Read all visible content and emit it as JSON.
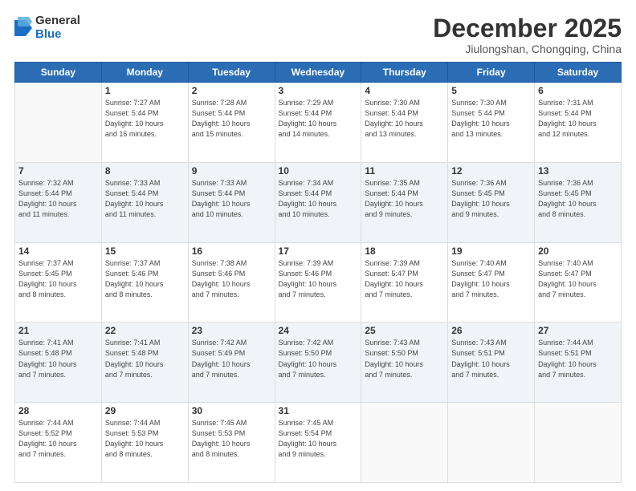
{
  "logo": {
    "general": "General",
    "blue": "Blue"
  },
  "header": {
    "month": "December 2025",
    "location": "Jiulongshan, Chongqing, China"
  },
  "weekdays": [
    "Sunday",
    "Monday",
    "Tuesday",
    "Wednesday",
    "Thursday",
    "Friday",
    "Saturday"
  ],
  "weeks": [
    [
      {
        "day": "",
        "info": ""
      },
      {
        "day": "1",
        "info": "Sunrise: 7:27 AM\nSunset: 5:44 PM\nDaylight: 10 hours\nand 16 minutes."
      },
      {
        "day": "2",
        "info": "Sunrise: 7:28 AM\nSunset: 5:44 PM\nDaylight: 10 hours\nand 15 minutes."
      },
      {
        "day": "3",
        "info": "Sunrise: 7:29 AM\nSunset: 5:44 PM\nDaylight: 10 hours\nand 14 minutes."
      },
      {
        "day": "4",
        "info": "Sunrise: 7:30 AM\nSunset: 5:44 PM\nDaylight: 10 hours\nand 13 minutes."
      },
      {
        "day": "5",
        "info": "Sunrise: 7:30 AM\nSunset: 5:44 PM\nDaylight: 10 hours\nand 13 minutes."
      },
      {
        "day": "6",
        "info": "Sunrise: 7:31 AM\nSunset: 5:44 PM\nDaylight: 10 hours\nand 12 minutes."
      }
    ],
    [
      {
        "day": "7",
        "info": "Sunrise: 7:32 AM\nSunset: 5:44 PM\nDaylight: 10 hours\nand 11 minutes."
      },
      {
        "day": "8",
        "info": "Sunrise: 7:33 AM\nSunset: 5:44 PM\nDaylight: 10 hours\nand 11 minutes."
      },
      {
        "day": "9",
        "info": "Sunrise: 7:33 AM\nSunset: 5:44 PM\nDaylight: 10 hours\nand 10 minutes."
      },
      {
        "day": "10",
        "info": "Sunrise: 7:34 AM\nSunset: 5:44 PM\nDaylight: 10 hours\nand 10 minutes."
      },
      {
        "day": "11",
        "info": "Sunrise: 7:35 AM\nSunset: 5:44 PM\nDaylight: 10 hours\nand 9 minutes."
      },
      {
        "day": "12",
        "info": "Sunrise: 7:36 AM\nSunset: 5:45 PM\nDaylight: 10 hours\nand 9 minutes."
      },
      {
        "day": "13",
        "info": "Sunrise: 7:36 AM\nSunset: 5:45 PM\nDaylight: 10 hours\nand 8 minutes."
      }
    ],
    [
      {
        "day": "14",
        "info": "Sunrise: 7:37 AM\nSunset: 5:45 PM\nDaylight: 10 hours\nand 8 minutes."
      },
      {
        "day": "15",
        "info": "Sunrise: 7:37 AM\nSunset: 5:46 PM\nDaylight: 10 hours\nand 8 minutes."
      },
      {
        "day": "16",
        "info": "Sunrise: 7:38 AM\nSunset: 5:46 PM\nDaylight: 10 hours\nand 7 minutes."
      },
      {
        "day": "17",
        "info": "Sunrise: 7:39 AM\nSunset: 5:46 PM\nDaylight: 10 hours\nand 7 minutes."
      },
      {
        "day": "18",
        "info": "Sunrise: 7:39 AM\nSunset: 5:47 PM\nDaylight: 10 hours\nand 7 minutes."
      },
      {
        "day": "19",
        "info": "Sunrise: 7:40 AM\nSunset: 5:47 PM\nDaylight: 10 hours\nand 7 minutes."
      },
      {
        "day": "20",
        "info": "Sunrise: 7:40 AM\nSunset: 5:47 PM\nDaylight: 10 hours\nand 7 minutes."
      }
    ],
    [
      {
        "day": "21",
        "info": "Sunrise: 7:41 AM\nSunset: 5:48 PM\nDaylight: 10 hours\nand 7 minutes."
      },
      {
        "day": "22",
        "info": "Sunrise: 7:41 AM\nSunset: 5:48 PM\nDaylight: 10 hours\nand 7 minutes."
      },
      {
        "day": "23",
        "info": "Sunrise: 7:42 AM\nSunset: 5:49 PM\nDaylight: 10 hours\nand 7 minutes."
      },
      {
        "day": "24",
        "info": "Sunrise: 7:42 AM\nSunset: 5:50 PM\nDaylight: 10 hours\nand 7 minutes."
      },
      {
        "day": "25",
        "info": "Sunrise: 7:43 AM\nSunset: 5:50 PM\nDaylight: 10 hours\nand 7 minutes."
      },
      {
        "day": "26",
        "info": "Sunrise: 7:43 AM\nSunset: 5:51 PM\nDaylight: 10 hours\nand 7 minutes."
      },
      {
        "day": "27",
        "info": "Sunrise: 7:44 AM\nSunset: 5:51 PM\nDaylight: 10 hours\nand 7 minutes."
      }
    ],
    [
      {
        "day": "28",
        "info": "Sunrise: 7:44 AM\nSunset: 5:52 PM\nDaylight: 10 hours\nand 7 minutes."
      },
      {
        "day": "29",
        "info": "Sunrise: 7:44 AM\nSunset: 5:53 PM\nDaylight: 10 hours\nand 8 minutes."
      },
      {
        "day": "30",
        "info": "Sunrise: 7:45 AM\nSunset: 5:53 PM\nDaylight: 10 hours\nand 8 minutes."
      },
      {
        "day": "31",
        "info": "Sunrise: 7:45 AM\nSunset: 5:54 PM\nDaylight: 10 hours\nand 9 minutes."
      },
      {
        "day": "",
        "info": ""
      },
      {
        "day": "",
        "info": ""
      },
      {
        "day": "",
        "info": ""
      }
    ]
  ]
}
